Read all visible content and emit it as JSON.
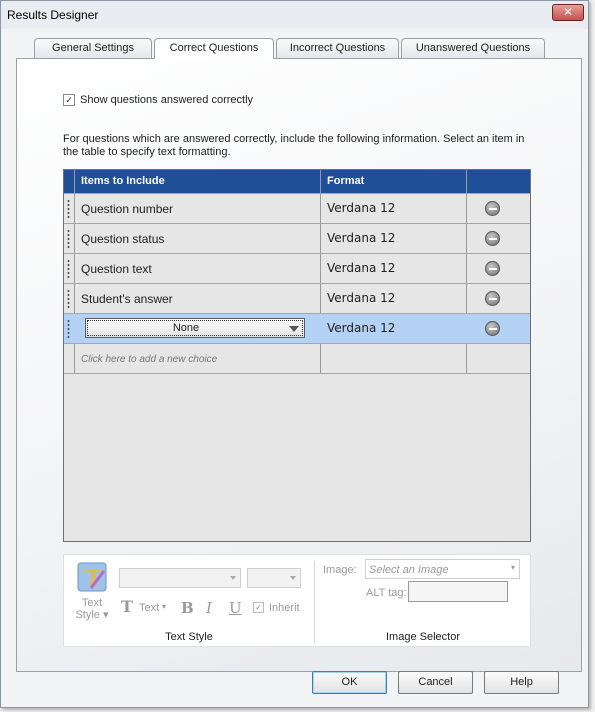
{
  "window": {
    "title": "Results Designer",
    "close_glyph": "✕"
  },
  "tabs": [
    {
      "label": "General Settings"
    },
    {
      "label": "Correct Questions"
    },
    {
      "label": "Incorrect Questions"
    },
    {
      "label": "Unanswered Questions"
    }
  ],
  "show_correct": {
    "label": "Show questions answered correctly",
    "checked": true,
    "glyph": "✓"
  },
  "description": "For questions which are answered correctly, include the following information. Select an item in the table to specify text formatting.",
  "grid": {
    "headers": {
      "items": "Items to Include",
      "format": "Format"
    },
    "rows": [
      {
        "item": "Question number",
        "format": "Verdana 12"
      },
      {
        "item": "Question status",
        "format": "Verdana 12"
      },
      {
        "item": "Question text",
        "format": "Verdana 12"
      },
      {
        "item": "Student's answer",
        "format": "Verdana 12"
      },
      {
        "item": "None",
        "format": "Verdana 12",
        "selected": true
      }
    ],
    "add_choice": "Click here to add a new choice"
  },
  "toolbar": {
    "text_style_label": "Text\nStyle",
    "text_style_line1": "Text",
    "text_style_line2": "Style",
    "text_label": "Text",
    "bold": "B",
    "italic": "I",
    "underline": "U",
    "inherit": "Inherit",
    "inherit_checked": true,
    "group_text_style": "Text Style",
    "image_label": "Image:",
    "image_placeholder": "Select an Image",
    "alt_label": "ALT tag:",
    "group_image_selector": "Image Selector"
  },
  "buttons": {
    "ok": "OK",
    "cancel": "Cancel",
    "help": "Help"
  }
}
